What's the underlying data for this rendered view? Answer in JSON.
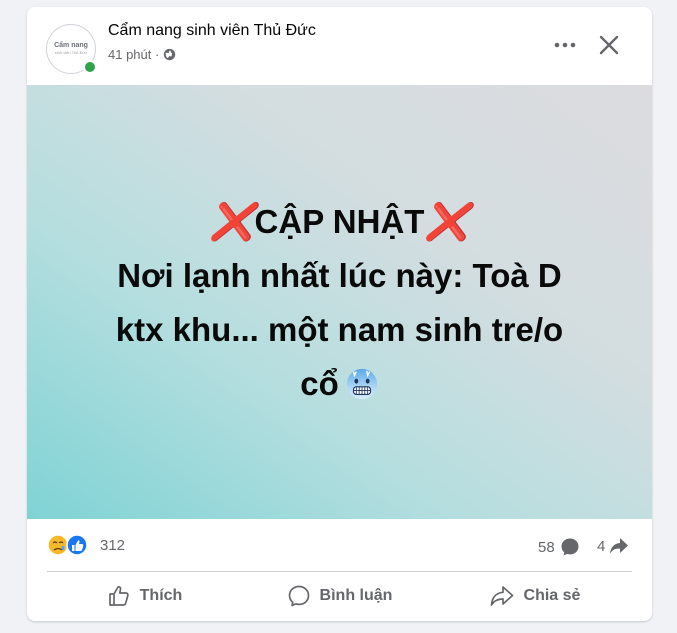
{
  "post": {
    "page_name": "Cẩm nang sinh viên Thủ Đức",
    "time": "41 phút ·",
    "privacy_icon": "globe-icon",
    "avatar": {
      "line1": "Cẩm nang",
      "line2": "sinh viên Thủ Đức"
    },
    "content": {
      "heading": "CẬP NHẬT",
      "heading_mark": "❌",
      "line1": "Nơi lạnh nhất lúc này: Toà D",
      "line2": "ktx khu... một nam sinh tre/o",
      "line3": "cổ",
      "emoji": "cold-face-emoji"
    },
    "background_colors": [
      "#7fd3d5",
      "#dcdcdf"
    ]
  },
  "reactions": {
    "icons": [
      "sad-reaction-icon",
      "like-reaction-icon"
    ],
    "count": "312",
    "comments": "58",
    "shares": "4"
  },
  "actions": {
    "like": "Thích",
    "comment": "Bình luận",
    "share": "Chia sẻ"
  },
  "colors": {
    "online": "#31a24c",
    "like_blue": "#1877f2",
    "mark_red": "#e0322e"
  }
}
